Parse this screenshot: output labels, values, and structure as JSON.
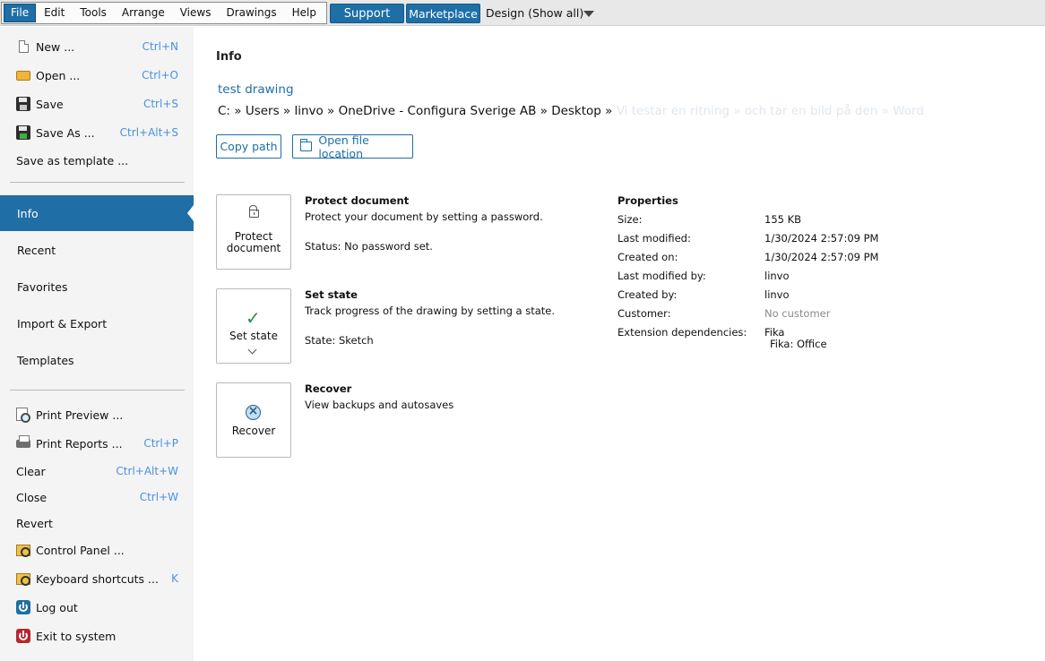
{
  "menubar": {
    "items": [
      "File",
      "Edit",
      "Tools",
      "Arrange",
      "Views",
      "Drawings",
      "Help"
    ],
    "active": "File",
    "support_label": "Support",
    "marketplace_label": "Marketplace",
    "design_label": "Design (Show all)"
  },
  "sidebar": {
    "file_actions": [
      {
        "label": "New ...",
        "shortcut": "Ctrl+N",
        "icon": "new-document-icon"
      },
      {
        "label": "Open ...",
        "shortcut": "Ctrl+O",
        "icon": "open-folder-icon"
      },
      {
        "label": "Save",
        "shortcut": "Ctrl+S",
        "icon": "save-icon"
      },
      {
        "label": "Save As ...",
        "shortcut": "Ctrl+Alt+S",
        "icon": "save-as-icon"
      },
      {
        "label": "Save as template ...",
        "shortcut": ""
      }
    ],
    "nav": [
      "Info",
      "Recent",
      "Favorites",
      "Import & Export",
      "Templates"
    ],
    "selected_nav": "Info",
    "bottom_actions": [
      {
        "label": "Print Preview ...",
        "shortcut": "",
        "icon": "print-preview-icon"
      },
      {
        "label": "Print Reports ...",
        "shortcut": "Ctrl+P",
        "icon": "printer-icon"
      },
      {
        "label": "Clear",
        "shortcut": "Ctrl+Alt+W"
      },
      {
        "label": "Close",
        "shortcut": "Ctrl+W"
      },
      {
        "label": "Revert",
        "shortcut": ""
      },
      {
        "label": "Control Panel ...",
        "shortcut": "",
        "icon": "control-panel-icon"
      },
      {
        "label": "Keyboard shortcuts ...",
        "shortcut": "K",
        "icon": "keyboard-shortcuts-icon"
      },
      {
        "label": "Log out",
        "shortcut": "",
        "icon": "log-out-icon"
      },
      {
        "label": "Exit to system",
        "shortcut": "",
        "icon": "exit-icon"
      }
    ]
  },
  "main": {
    "title": "Info",
    "document_name": "test drawing",
    "path": "C: » Users » linvo » OneDrive - Configura Sverige AB » Desktop »",
    "path_overflow": "Vi testar en ritning » och tar en bild på den » Word",
    "copy_path_label": "Copy path",
    "open_location_label": "Open file location",
    "cards": {
      "protect": {
        "button_label_1": "Protect",
        "button_label_2": "document",
        "heading": "Protect document",
        "description": "Protect your document by setting a password.",
        "status": "Status:  No password set."
      },
      "state": {
        "button_label": "Set state",
        "heading": "Set state",
        "description": "Track progress of the drawing by setting a state.",
        "status": "State:  Sketch"
      },
      "recover": {
        "button_label": "Recover",
        "heading": "Recover",
        "description": "View backups and autosaves"
      }
    },
    "properties": {
      "heading": "Properties",
      "rows": [
        {
          "key": "Size:",
          "value": "155 KB"
        },
        {
          "key": "Last modified:",
          "value": "1/30/2024 2:57:09 PM"
        },
        {
          "key": "Created on:",
          "value": "1/30/2024 2:57:09 PM"
        },
        {
          "key": "Last modified by:",
          "value": "linvo"
        },
        {
          "key": "Created by:",
          "value": "linvo"
        },
        {
          "key": "Customer:",
          "value": "No customer"
        },
        {
          "key": "Extension dependencies:",
          "value": "Fika",
          "value2": "Fika: Office"
        }
      ]
    }
  }
}
